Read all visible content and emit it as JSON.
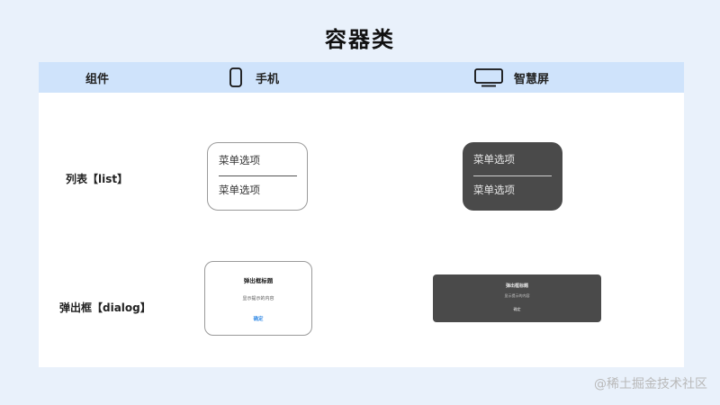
{
  "page": {
    "title": "容器类"
  },
  "header": {
    "component": "组件",
    "phone": {
      "label": "手机",
      "icon": "phone-icon"
    },
    "smart_screen": {
      "label": "智慧屏",
      "icon": "tv-screen-icon"
    }
  },
  "rows": {
    "list": {
      "label": "列表【list】",
      "items": [
        "菜单选项",
        "菜单选项"
      ]
    },
    "dialog": {
      "label": "弹出框【dialog】",
      "title": "弹出框标题",
      "content": "显示提示的内容",
      "button": "确定"
    }
  },
  "colors": {
    "header_bg": "#cfe3fb",
    "dark_card": "#4a4a4a",
    "accent_blue": "#3a8ee6"
  },
  "watermark": "@稀土掘金技术社区"
}
